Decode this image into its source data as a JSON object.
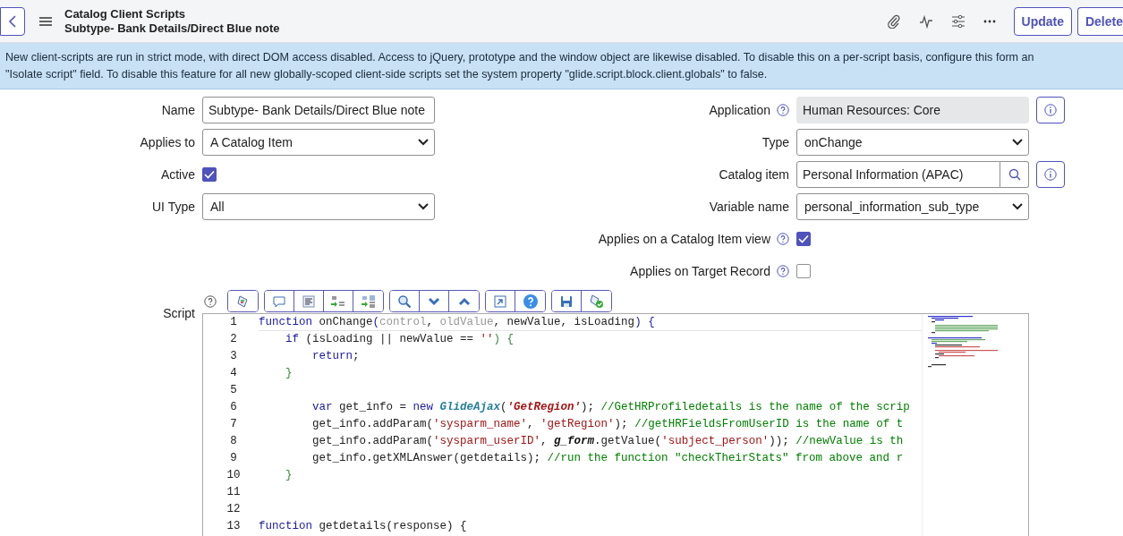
{
  "header": {
    "title": "Catalog Client Scripts",
    "subtitle": "Subtype- Bank Details/Direct Blue note",
    "buttons": [
      {
        "label": "Update"
      },
      {
        "label": "Delete"
      }
    ]
  },
  "banner": {
    "lines": [
      "New client-scripts are run in strict mode, with direct DOM access disabled. Access to jQuery, prototype and the window object are likewise disabled. To disable this on a per-script basis, configure this form an",
      "\"Isolate script\" field. To disable this feature for all new globally-scoped client-side scripts set the system property \"glide.script.block.client.globals\" to false."
    ]
  },
  "rows": [
    {
      "left": {
        "label": "Name",
        "kind": "text",
        "value": "Subtype- Bank Details/Direct Blue note"
      },
      "right": {
        "label": "Application",
        "kind": "readonly",
        "value": "Human Resources: Core",
        "help": true,
        "info": true
      }
    },
    {
      "left": {
        "label": "Applies to",
        "kind": "select",
        "value": "A Catalog Item"
      },
      "right": {
        "label": "Type",
        "kind": "select",
        "value": "onChange"
      }
    },
    {
      "left": {
        "label": "Active",
        "kind": "checkbox",
        "checked": true
      },
      "right": {
        "label": "Catalog item",
        "kind": "reference",
        "value": "Personal Information (APAC)",
        "info": true
      }
    },
    {
      "left": {
        "label": "UI Type",
        "kind": "select",
        "value": "All"
      },
      "right": {
        "label": "Variable name",
        "kind": "select",
        "value": "personal_information_sub_type"
      }
    }
  ],
  "checks": [
    {
      "label": "Applies on a Catalog Item view",
      "checked": true
    },
    {
      "label": "Applies on Target Record",
      "checked": false
    }
  ],
  "script": {
    "label": "Script",
    "lines": [
      {
        "number": "1",
        "tokens": [
          {
            "text": "function ",
            "kind": "kw"
          },
          {
            "text": "onChange",
            "kind": "plain"
          },
          {
            "text": "(",
            "kind": "kw"
          },
          {
            "text": "control",
            "kind": "param"
          },
          {
            "text": ", ",
            "kind": "plain"
          },
          {
            "text": "oldValue",
            "kind": "param"
          },
          {
            "text": ", newValue, isLoading",
            "kind": "plain"
          },
          {
            "text": ") {",
            "kind": "kw"
          }
        ]
      },
      {
        "number": "2",
        "tokens": [
          {
            "text": "    if ",
            "kind": "kw"
          },
          {
            "text": "(isLoading || newValue == ",
            "kind": "plain"
          },
          {
            "text": "''",
            "kind": "str"
          },
          {
            "text": ") {",
            "kind": "punct"
          }
        ]
      },
      {
        "number": "3",
        "tokens": [
          {
            "text": "        return",
            "kind": "kw"
          },
          {
            "text": ";",
            "kind": "plain"
          }
        ]
      },
      {
        "number": "4",
        "tokens": [
          {
            "text": "    }",
            "kind": "punct"
          }
        ]
      },
      {
        "number": "5"
      },
      {
        "number": "6",
        "tokens": [
          {
            "text": "        var ",
            "kind": "kw"
          },
          {
            "text": "get_info = ",
            "kind": "plain"
          },
          {
            "text": "new ",
            "kind": "kw"
          },
          {
            "text": "GlideAjax",
            "kind": "cls"
          },
          {
            "text": "(",
            "kind": "plain"
          },
          {
            "text": "'GetRegion'",
            "kind": "strb"
          },
          {
            "text": "); ",
            "kind": "plain"
          },
          {
            "text": "//GetHRProfiledetails is the name of the scrip",
            "kind": "cmt"
          }
        ]
      },
      {
        "number": "7",
        "tokens": [
          {
            "text": "        get_info.addParam(",
            "kind": "plain"
          },
          {
            "text": "'sysparm_name'",
            "kind": "str"
          },
          {
            "text": ", ",
            "kind": "plain"
          },
          {
            "text": "'getRegion'",
            "kind": "str"
          },
          {
            "text": "); ",
            "kind": "plain"
          },
          {
            "text": "//getHRFieldsFromUserID is the name of t",
            "kind": "cmt"
          }
        ]
      },
      {
        "number": "8",
        "tokens": [
          {
            "text": "        get_info.addParam(",
            "kind": "plain"
          },
          {
            "text": "'sysparm_userID'",
            "kind": "str"
          },
          {
            "text": ", ",
            "kind": "plain"
          },
          {
            "text": "g_form",
            "kind": "bi"
          },
          {
            "text": ".getValue(",
            "kind": "plain"
          },
          {
            "text": "'subject_person'",
            "kind": "str"
          },
          {
            "text": ")); ",
            "kind": "plain"
          },
          {
            "text": "//newValue is th",
            "kind": "cmt"
          }
        ]
      },
      {
        "number": "9",
        "tokens": [
          {
            "text": "        get_info.getXMLAnswer(getdetails); ",
            "kind": "plain"
          },
          {
            "text": "//run the function \"checkTheirStats\" from above and r",
            "kind": "cmt"
          }
        ]
      },
      {
        "number": "10",
        "tokens": [
          {
            "text": "    }",
            "kind": "punct"
          }
        ]
      },
      {
        "number": "11"
      },
      {
        "number": "12"
      },
      {
        "number": "13",
        "tokens": [
          {
            "text": "function ",
            "kind": "kw"
          },
          {
            "text": "getdetails(response) {",
            "kind": "plain"
          }
        ]
      }
    ]
  }
}
